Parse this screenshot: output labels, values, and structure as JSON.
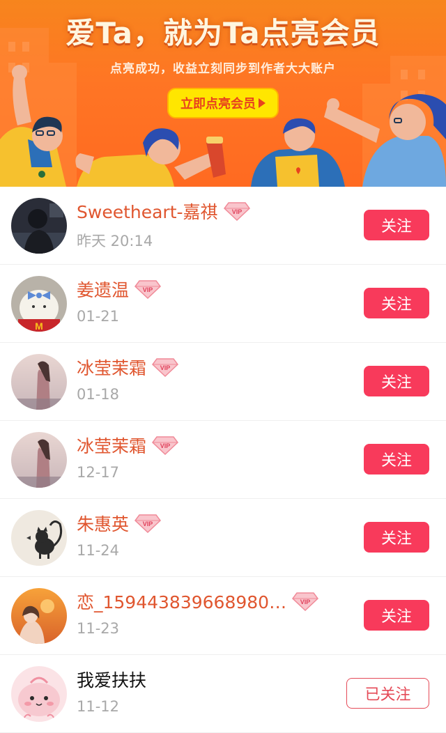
{
  "banner": {
    "title": "爱Ta，就为Ta点亮会员",
    "subtitle": "点亮成功，收益立刻同步到作者大大账户",
    "cta_label": "立即点亮会员"
  },
  "colors": {
    "banner_orange": "#ff7524",
    "cta_yellow": "#ffe600",
    "accent_red": "#f83a5b",
    "vip_name": "#e0562f",
    "date_gray": "#a8a8a8"
  },
  "users": [
    {
      "name": "Sweetheart-嘉祺",
      "date": "昨天 20:14",
      "vip": true,
      "button": "关注",
      "followed": false,
      "avatar": "dark-photo-avatar"
    },
    {
      "name": "姜遗温",
      "date": "01-21",
      "vip": true,
      "button": "关注",
      "followed": false,
      "avatar": "plush-toy-avatar"
    },
    {
      "name": "冰莹茉霜",
      "date": "01-18",
      "vip": true,
      "button": "关注",
      "followed": false,
      "avatar": "girl-sunset-avatar"
    },
    {
      "name": "冰莹茉霜",
      "date": "12-17",
      "vip": true,
      "button": "关注",
      "followed": false,
      "avatar": "girl-sunset-avatar"
    },
    {
      "name": "朱惠英",
      "date": "11-24",
      "vip": true,
      "button": "关注",
      "followed": false,
      "avatar": "cat-sketch-avatar"
    },
    {
      "name": "恋_159443839668980…",
      "date": "11-23",
      "vip": true,
      "button": "关注",
      "followed": false,
      "avatar": "orange-sunset-avatar"
    },
    {
      "name": "我爱扶扶",
      "date": "11-12",
      "vip": false,
      "button": "已关注",
      "followed": true,
      "avatar": "pink-cartoon-avatar"
    }
  ]
}
